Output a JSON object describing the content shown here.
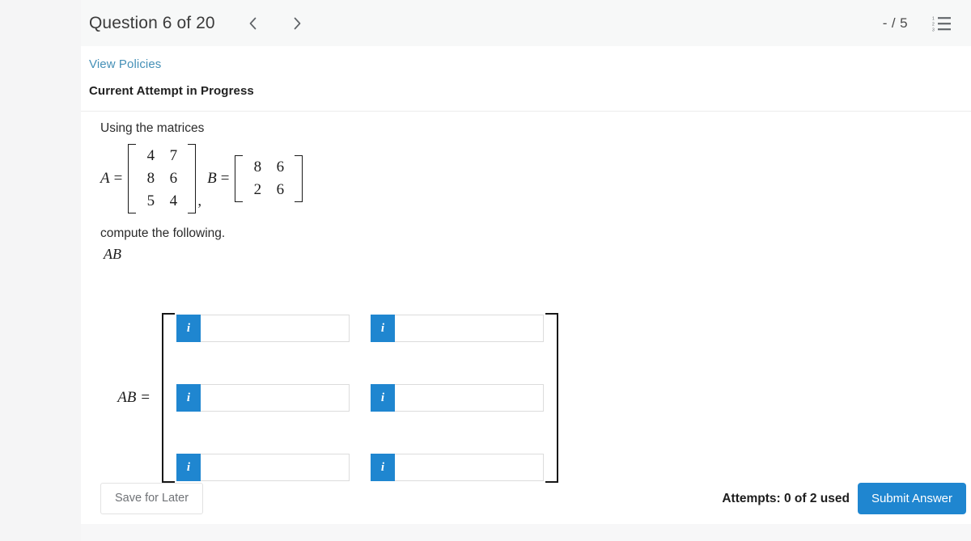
{
  "header": {
    "question_title": "Question 6 of 20",
    "prev_label": "‹",
    "next_label": "›",
    "score": "- / 5"
  },
  "card": {
    "policies_link": "View Policies",
    "attempt_heading": "Current Attempt in Progress"
  },
  "question": {
    "intro": "Using the matrices",
    "compute": "compute the following.",
    "expression": "AB",
    "matrix_a": {
      "name": "A",
      "equals": "=",
      "rows": [
        [
          "4",
          "7"
        ],
        [
          "8",
          "6"
        ],
        [
          "5",
          "4"
        ]
      ]
    },
    "separator": ",",
    "matrix_b": {
      "name": "B",
      "equals": "=",
      "rows": [
        [
          "8",
          "6"
        ],
        [
          "2",
          "6"
        ]
      ]
    }
  },
  "answer": {
    "label": "AB =",
    "info_glyph": "i",
    "rows": [
      [
        {
          "value": "",
          "placeholder": ""
        },
        {
          "value": "",
          "placeholder": ""
        }
      ],
      [
        {
          "value": "",
          "placeholder": ""
        },
        {
          "value": "",
          "placeholder": ""
        }
      ],
      [
        {
          "value": "",
          "placeholder": ""
        },
        {
          "value": "",
          "placeholder": ""
        }
      ]
    ]
  },
  "footer": {
    "save_label": "Save for Later",
    "attempts_text": "Attempts: 0 of 2 used",
    "submit_label": "Submit Answer"
  },
  "colors": {
    "accent_blue": "#1f86d0",
    "link_blue": "#4590b7",
    "page_bg": "#f5f5f6",
    "header_bg": "#f7f8f8"
  }
}
